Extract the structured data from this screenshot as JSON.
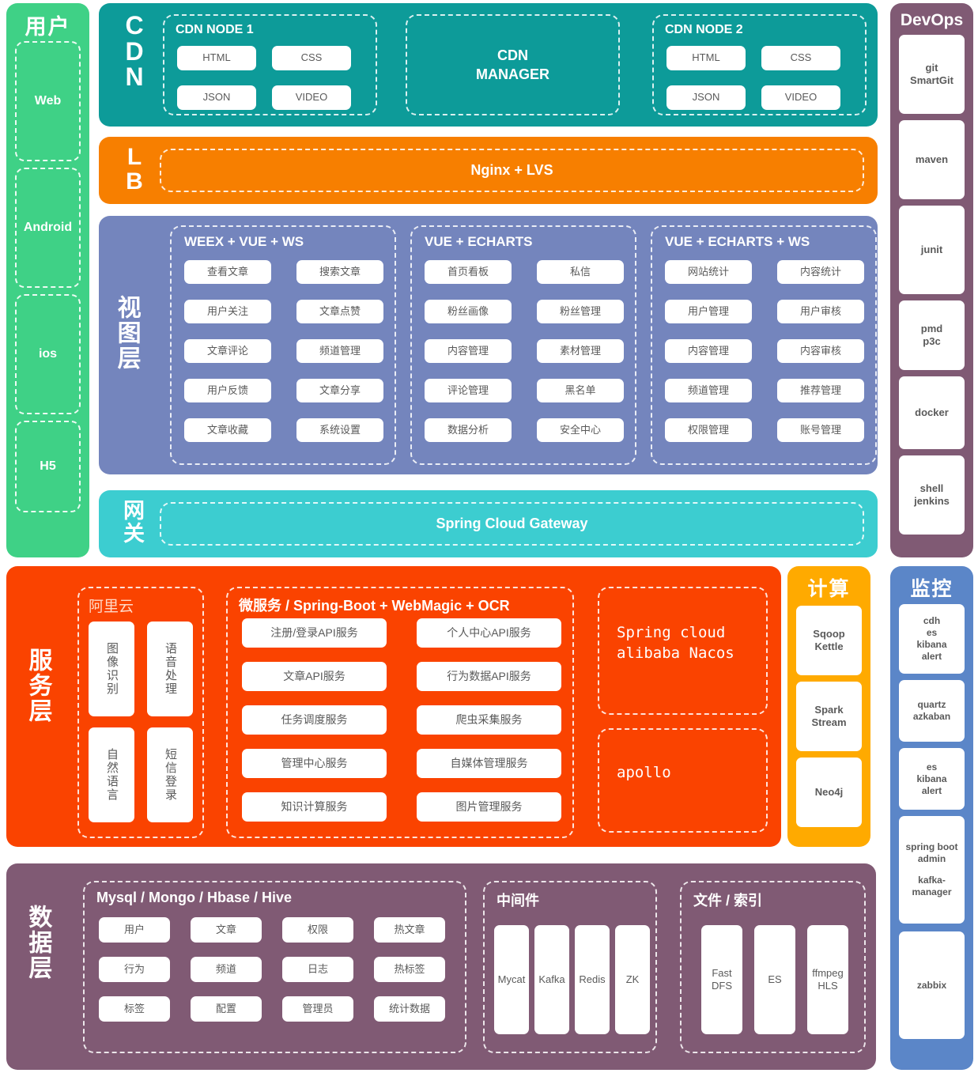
{
  "user": {
    "title": "用户",
    "items": [
      {
        "label": "Web"
      },
      {
        "label": "Android"
      },
      {
        "label": "ios"
      },
      {
        "label": "H5"
      }
    ],
    "color": "#3fd186"
  },
  "cdn": {
    "letters": "CDN",
    "color": "#0d9b99",
    "node1": {
      "title": "CDN NODE 1",
      "chips": [
        "HTML",
        "CSS",
        "JSON",
        "VIDEO"
      ]
    },
    "manager": "CDN\nMANAGER",
    "manager_line1": "CDN",
    "manager_line2": "MANAGER",
    "node2": {
      "title": "CDN NODE 2",
      "chips": [
        "HTML",
        "CSS",
        "JSON",
        "VIDEO"
      ]
    }
  },
  "lb": {
    "letters": "LB",
    "label": "Nginx + LVS",
    "color": "#f77f00"
  },
  "view_layer": {
    "title": "视图层",
    "color": "#7485bd",
    "columns": [
      {
        "title": "WEEX + VUE + WS",
        "chips": [
          "查看文章",
          "搜索文章",
          "用户关注",
          "文章点赞",
          "文章评论",
          "频道管理",
          "用户反馈",
          "文章分享",
          "文章收藏",
          "系统设置"
        ]
      },
      {
        "title": "VUE + ECHARTS",
        "chips": [
          "首页看板",
          "私信",
          "粉丝画像",
          "粉丝管理",
          "内容管理",
          "素材管理",
          "评论管理",
          "黑名单",
          "数据分析",
          "安全中心"
        ]
      },
      {
        "title": "VUE +  ECHARTS + WS",
        "chips": [
          "网站统计",
          "内容统计",
          "用户管理",
          "用户审核",
          "内容管理",
          "内容审核",
          "频道管理",
          "推荐管理",
          "权限管理",
          "账号管理"
        ]
      }
    ]
  },
  "gateway": {
    "title": "网关",
    "label": "Spring Cloud Gateway",
    "color": "#3ccdd0"
  },
  "devops": {
    "title": "DevOps",
    "color": "#805a74",
    "chips": [
      {
        "lines": [
          "git",
          "SmartGit"
        ]
      },
      {
        "lines": [
          "maven"
        ]
      },
      {
        "lines": [
          "junit"
        ]
      },
      {
        "lines": [
          "pmd",
          "p3c"
        ]
      },
      {
        "lines": [
          "docker"
        ]
      },
      {
        "lines": [
          "shell",
          "jenkins"
        ]
      }
    ]
  },
  "service_layer": {
    "title": "服务层",
    "color": "#fa4300",
    "alicloud": {
      "title": "阿里云",
      "chips": [
        "图像识别",
        "语音处理",
        "自然语言",
        "短信登录"
      ]
    },
    "microservice": {
      "title": "微服务 / Spring-Boot + WebMagic + OCR",
      "chips": [
        "注册/登录API服务",
        "个人中心API服务",
        "文章API服务",
        "行为数据API服务",
        "任务调度服务",
        "爬虫采集服务",
        "管理中心服务",
        "自媒体管理服务",
        "知识计算服务",
        "图片管理服务"
      ]
    },
    "registry": {
      "line1": "Spring cloud",
      "line2": "alibaba Nacos"
    },
    "config": {
      "line1": "apollo"
    }
  },
  "compute": {
    "title": "计算",
    "color": "#ffaa00",
    "chips": [
      {
        "lines": [
          "Sqoop",
          "Kettle"
        ]
      },
      {
        "lines": [
          "Spark",
          "Stream"
        ]
      },
      {
        "lines": [
          "Neo4j"
        ]
      }
    ]
  },
  "monitor": {
    "title": "监控",
    "color": "#5b86c8",
    "chips": [
      {
        "lines": [
          "cdh",
          "es",
          "kibana",
          "alert"
        ]
      },
      {
        "lines": [
          "quartz",
          "azkaban"
        ]
      },
      {
        "lines": [
          "es",
          "kibana",
          "alert"
        ]
      },
      {
        "lines": [
          "spring boot",
          "admin"
        ],
        "sub": [
          "kafka-",
          "manager"
        ]
      },
      {
        "lines": [
          "zabbix"
        ]
      }
    ]
  },
  "data_layer": {
    "title": "数据层",
    "color": "#805a74",
    "db": {
      "title": "Mysql / Mongo / Hbase / Hive",
      "chips": [
        "用户",
        "文章",
        "权限",
        "热文章",
        "行为",
        "频道",
        "日志",
        "热标签",
        "标签",
        "配置",
        "管理员",
        "统计数据"
      ]
    },
    "middleware": {
      "title": "中间件",
      "chips": [
        "Mycat",
        "Kafka",
        "Redis",
        "ZK"
      ]
    },
    "files": {
      "title": "文件 / 索引",
      "chips": [
        {
          "lines": [
            "Fast",
            "DFS"
          ]
        },
        {
          "lines": [
            "ES"
          ]
        },
        {
          "lines": [
            "ffmpeg",
            "HLS"
          ]
        }
      ]
    }
  }
}
